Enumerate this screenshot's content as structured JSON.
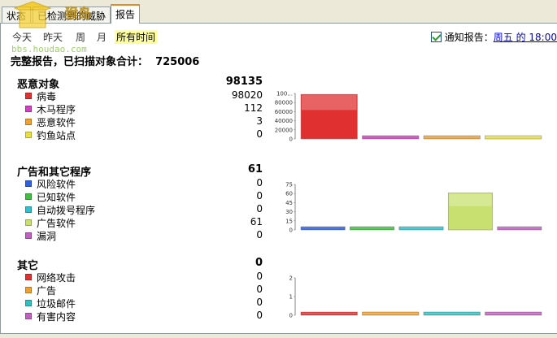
{
  "tabs": [
    {
      "label": "状态",
      "active": false
    },
    {
      "label": "已检测到的威胁",
      "active": false
    },
    {
      "label": "报告",
      "active": true
    }
  ],
  "filters": [
    {
      "label": "今天",
      "selected": false
    },
    {
      "label": "昨天",
      "selected": false
    },
    {
      "label": "周",
      "selected": false
    },
    {
      "label": "月",
      "selected": false
    },
    {
      "label": "所有时间",
      "selected": true
    }
  ],
  "notify": {
    "label": "通知报告：",
    "link": "周五 的 18:00",
    "checked": true
  },
  "summary": {
    "label": "完整报告，已扫描对象合计：",
    "value": "725006"
  },
  "watermark": {
    "text": "bbs.houdao.com"
  },
  "sections": [
    {
      "title": "恶意对象",
      "total": "98135",
      "items": [
        {
          "label": "病毒",
          "value": "98020",
          "color": "#e03030"
        },
        {
          "label": "木马程序",
          "value": "112",
          "color": "#d040c0"
        },
        {
          "label": "恶意软件",
          "value": "3",
          "color": "#f0a030"
        },
        {
          "label": "钓鱼站点",
          "value": "0",
          "color": "#e8e040"
        }
      ],
      "y_ticks": [
        "100...",
        "80000",
        "60000",
        "40000",
        "20000",
        "0"
      ]
    },
    {
      "title": "广告和其它程序",
      "total": "61",
      "items": [
        {
          "label": "风险软件",
          "value": "0",
          "color": "#3060e0"
        },
        {
          "label": "已知软件",
          "value": "0",
          "color": "#40c040"
        },
        {
          "label": "自动拨号程序",
          "value": "0",
          "color": "#30c0d0"
        },
        {
          "label": "广告软件",
          "value": "61",
          "color": "#c8e070"
        },
        {
          "label": "漏洞",
          "value": "0",
          "color": "#c060c0"
        }
      ],
      "y_ticks": [
        "75",
        "60",
        "45",
        "30",
        "15",
        "0"
      ]
    },
    {
      "title": "其它",
      "total": "0",
      "items": [
        {
          "label": "网络攻击",
          "value": "0",
          "color": "#e03030"
        },
        {
          "label": "广告",
          "value": "0",
          "color": "#f0a030"
        },
        {
          "label": "垃圾邮件",
          "value": "0",
          "color": "#30c0c0"
        },
        {
          "label": "有害内容",
          "value": "0",
          "color": "#c060c0"
        }
      ],
      "y_ticks": [
        "2",
        "1",
        "0"
      ]
    }
  ],
  "chart_data": [
    {
      "type": "bar",
      "categories": [
        "病毒",
        "木马程序",
        "恶意软件",
        "钓鱼站点"
      ],
      "values": [
        98020,
        112,
        3,
        0
      ],
      "ylim": [
        0,
        100000
      ]
    },
    {
      "type": "bar",
      "categories": [
        "风险软件",
        "已知软件",
        "自动拨号程序",
        "广告软件",
        "漏洞"
      ],
      "values": [
        0,
        0,
        0,
        61,
        0
      ],
      "ylim": [
        0,
        75
      ]
    },
    {
      "type": "bar",
      "categories": [
        "网络攻击",
        "广告",
        "垃圾邮件",
        "有害内容"
      ],
      "values": [
        0,
        0,
        0,
        0
      ],
      "ylim": [
        0,
        2
      ]
    }
  ]
}
